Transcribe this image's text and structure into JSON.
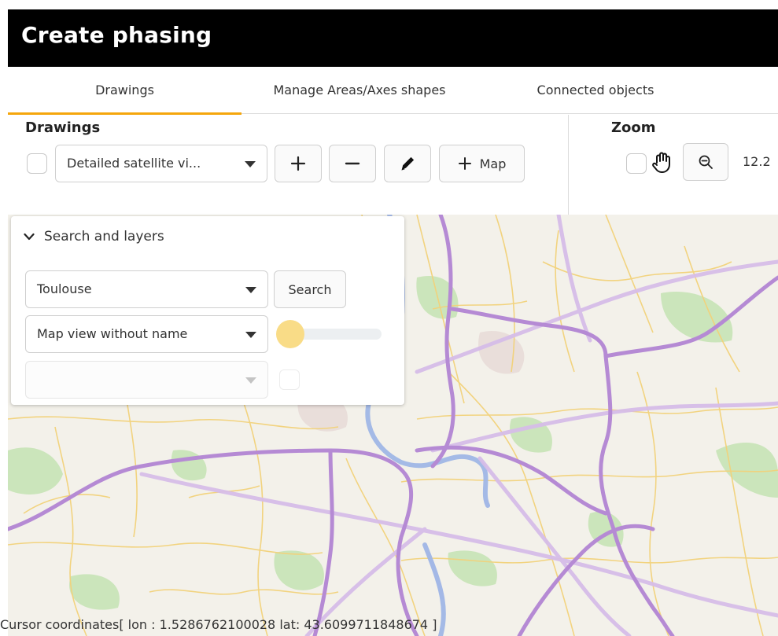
{
  "window": {
    "title": "Create phasing"
  },
  "tabs": [
    {
      "label": "Drawings",
      "active": true
    },
    {
      "label": "Manage Areas/Axes shapes",
      "active": false
    },
    {
      "label": "Connected objects",
      "active": false
    }
  ],
  "drawings": {
    "title": "Drawings",
    "select_value": "Detailed satellite vi...",
    "add_map_label": "Map",
    "icons": [
      "plus-icon",
      "minus-icon",
      "pencil-icon",
      "plus-icon"
    ]
  },
  "zoom": {
    "title": "Zoom",
    "level": "12.2",
    "icons": [
      "hand-icon",
      "zoom-out-icon"
    ]
  },
  "search_panel": {
    "header": "Search and layers",
    "location_value": "Toulouse",
    "search_button": "Search",
    "view_value": "Map view without name",
    "third_select_value": "",
    "opacity_level": 0.0
  },
  "status": {
    "prefix": "Cursor coordinates[ lon : ",
    "lon": "1.5286762100028",
    "lat_label": " lat: ",
    "lat": "43.6099711848674",
    "suffix": " ]"
  },
  "colors": {
    "accent": "#f5a60c",
    "major_road": "#b58ad4",
    "secondary_road": "#d6bde8",
    "minor_road": "#f2d27a",
    "river": "#9fb6e6",
    "park": "#c6e3b6",
    "slider_thumb": "#f9dc87"
  }
}
